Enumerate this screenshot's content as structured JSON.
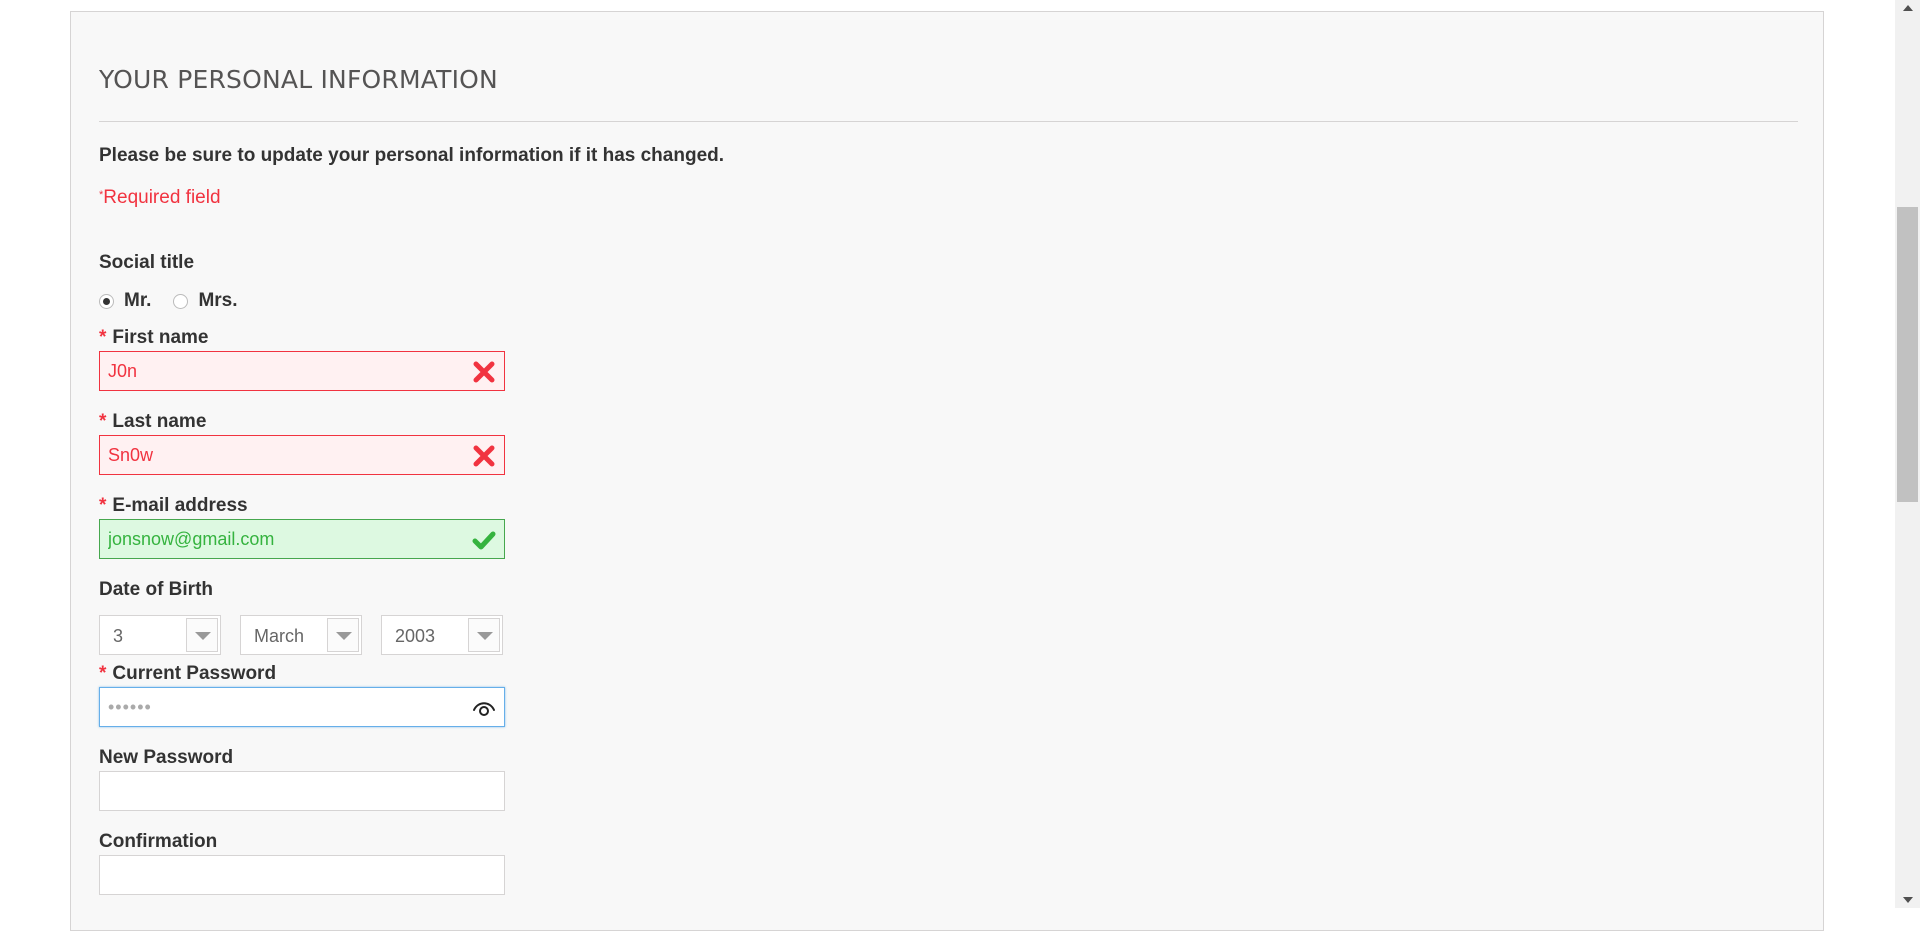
{
  "section": {
    "title": "YOUR PERSONAL INFORMATION",
    "intro": "Please be sure to update your personal information if it has changed.",
    "required_mark": "*",
    "required_note": "Required field"
  },
  "form": {
    "required_star": "*",
    "social_title": {
      "label": "Social title",
      "options": [
        "Mr.",
        "Mrs."
      ],
      "selected": "Mr."
    },
    "first_name": {
      "label": "First name",
      "value": "J0n",
      "status": "error"
    },
    "last_name": {
      "label": "Last name",
      "value": "Sn0w",
      "status": "error"
    },
    "email": {
      "label": "E-mail address",
      "value": "jonsnow@gmail.com",
      "status": "valid"
    },
    "dob": {
      "label": "Date of Birth",
      "day": "3",
      "month": "March",
      "year": "2003"
    },
    "current_password": {
      "label": "Current Password",
      "value": "••••••"
    },
    "new_password": {
      "label": "New Password",
      "value": ""
    },
    "confirmation": {
      "label": "Confirmation",
      "value": ""
    }
  },
  "icons": {
    "error": "x-icon",
    "valid": "check-icon",
    "show_password": "eye-icon"
  },
  "colors": {
    "error": "#f13340",
    "error_bg": "#fff1f2",
    "valid": "#35b33f",
    "valid_bg": "#ddf9e1",
    "focus": "#66afe9"
  }
}
